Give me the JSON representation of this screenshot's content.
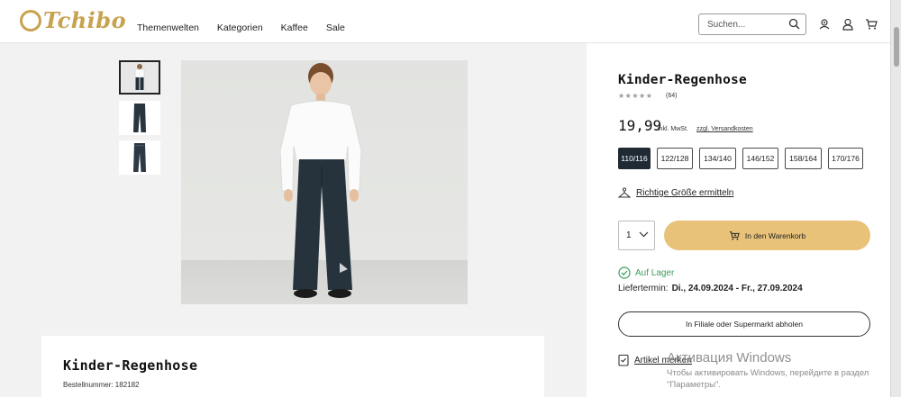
{
  "header": {
    "logo_text": "Tchibo",
    "nav": [
      "Themenwelten",
      "Kategorien",
      "Kaffee",
      "Sale"
    ],
    "search_placeholder": "Suchen...",
    "icons": [
      "search-icon",
      "store-locator-icon",
      "account-icon",
      "cart-icon"
    ]
  },
  "gallery": {
    "thumbnails": [
      "product-model",
      "product-front",
      "product-back"
    ],
    "active_thumbnail": 0
  },
  "product": {
    "title": "Kinder-Regenhose",
    "rating_stars": "★★★★★",
    "rating_count": "(64)",
    "price": "19,99",
    "vat_note": "inkl. MwSt.",
    "shipping_link": "zzgl. Versandkosten",
    "sizes": [
      "110/116",
      "122/128",
      "134/140",
      "146/152",
      "158/164",
      "170/176"
    ],
    "selected_size": "110/116",
    "size_finder": "Richtige Größe ermitteln",
    "quantity": "1",
    "add_to_cart": "In den Warenkorb",
    "stock_status": "Auf Lager",
    "delivery_label": "Liefertermin:",
    "delivery_dates": "Di., 24.09.2024 - Fr., 27.09.2024",
    "store_pickup": "In Filiale oder Supermarkt abholen",
    "wishlist": "Artikel merken"
  },
  "details_card": {
    "title": "Kinder-Regenhose",
    "order_number": "Bestellnummer: 182182"
  },
  "watermark": {
    "title": "Активация Windows",
    "line1": "Чтобы активировать Windows, перейдите в раздел",
    "line2": "\"Параметры\"."
  },
  "colors": {
    "brand_gold": "#c7a24f",
    "cart_button": "#e9c27a",
    "selected_size_bg": "#1f2a35",
    "stock_green": "#3c9e5c"
  }
}
